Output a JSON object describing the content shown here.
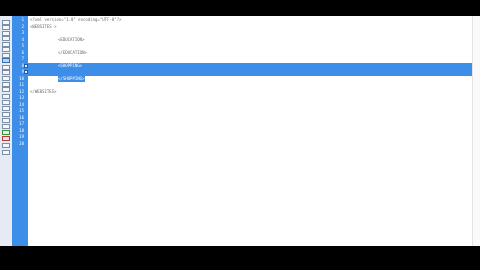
{
  "editor": {
    "lines": [
      {
        "num": "1",
        "text": "<?xml version=\"1.0\" encoding=\"UTF-8\"?>",
        "indent": 0
      },
      {
        "num": "2",
        "text": "<WEBSITES >",
        "indent": 0
      },
      {
        "num": "3",
        "text": "",
        "indent": 0
      },
      {
        "num": "4",
        "text": "<EDUCATION>",
        "indent": 1
      },
      {
        "num": "5",
        "text": "",
        "indent": 0
      },
      {
        "num": "6",
        "text": "</EDUCATION>",
        "indent": 1
      },
      {
        "num": "7",
        "text": "",
        "indent": 0
      },
      {
        "num": "8",
        "text": "<SHOPPING>",
        "indent": 1
      },
      {
        "num": "9",
        "text": "",
        "indent": 0
      },
      {
        "num": "10",
        "text": "</SHOPPING>",
        "indent": 1
      },
      {
        "num": "11",
        "text": "",
        "indent": 0
      },
      {
        "num": "12",
        "text": "</WEBSITES>",
        "indent": 0
      },
      {
        "num": "13",
        "text": "",
        "indent": 0
      },
      {
        "num": "14",
        "text": "",
        "indent": 0
      },
      {
        "num": "15",
        "text": "",
        "indent": 0
      },
      {
        "num": "16",
        "text": "",
        "indent": 0
      },
      {
        "num": "17",
        "text": "",
        "indent": 0
      },
      {
        "num": "18",
        "text": "",
        "indent": 0
      },
      {
        "num": "19",
        "text": "",
        "indent": 0
      },
      {
        "num": "20",
        "text": "",
        "indent": 0
      }
    ],
    "selected_lines": [
      "8",
      "9"
    ],
    "inline_highlight_line": "10"
  },
  "toolbar": {
    "tools": [
      "file-icon",
      "open-icon",
      "save-icon",
      "cut-icon",
      "copy-icon",
      "paste-icon",
      "find-icon",
      "select-tool-icon",
      "undo-icon",
      "redo-icon",
      "cursor-icon",
      "comment-icon",
      "indent-icon",
      "outdent-icon",
      "bookmark-icon",
      "format-icon",
      "tag-icon",
      "validate-icon",
      "zoom-icon",
      "run-icon",
      "stop-icon",
      "settings-icon",
      "help-icon"
    ]
  },
  "colors": {
    "accent": "#3d8ee8",
    "frame": "#000000",
    "text": "#6a6a6a"
  }
}
